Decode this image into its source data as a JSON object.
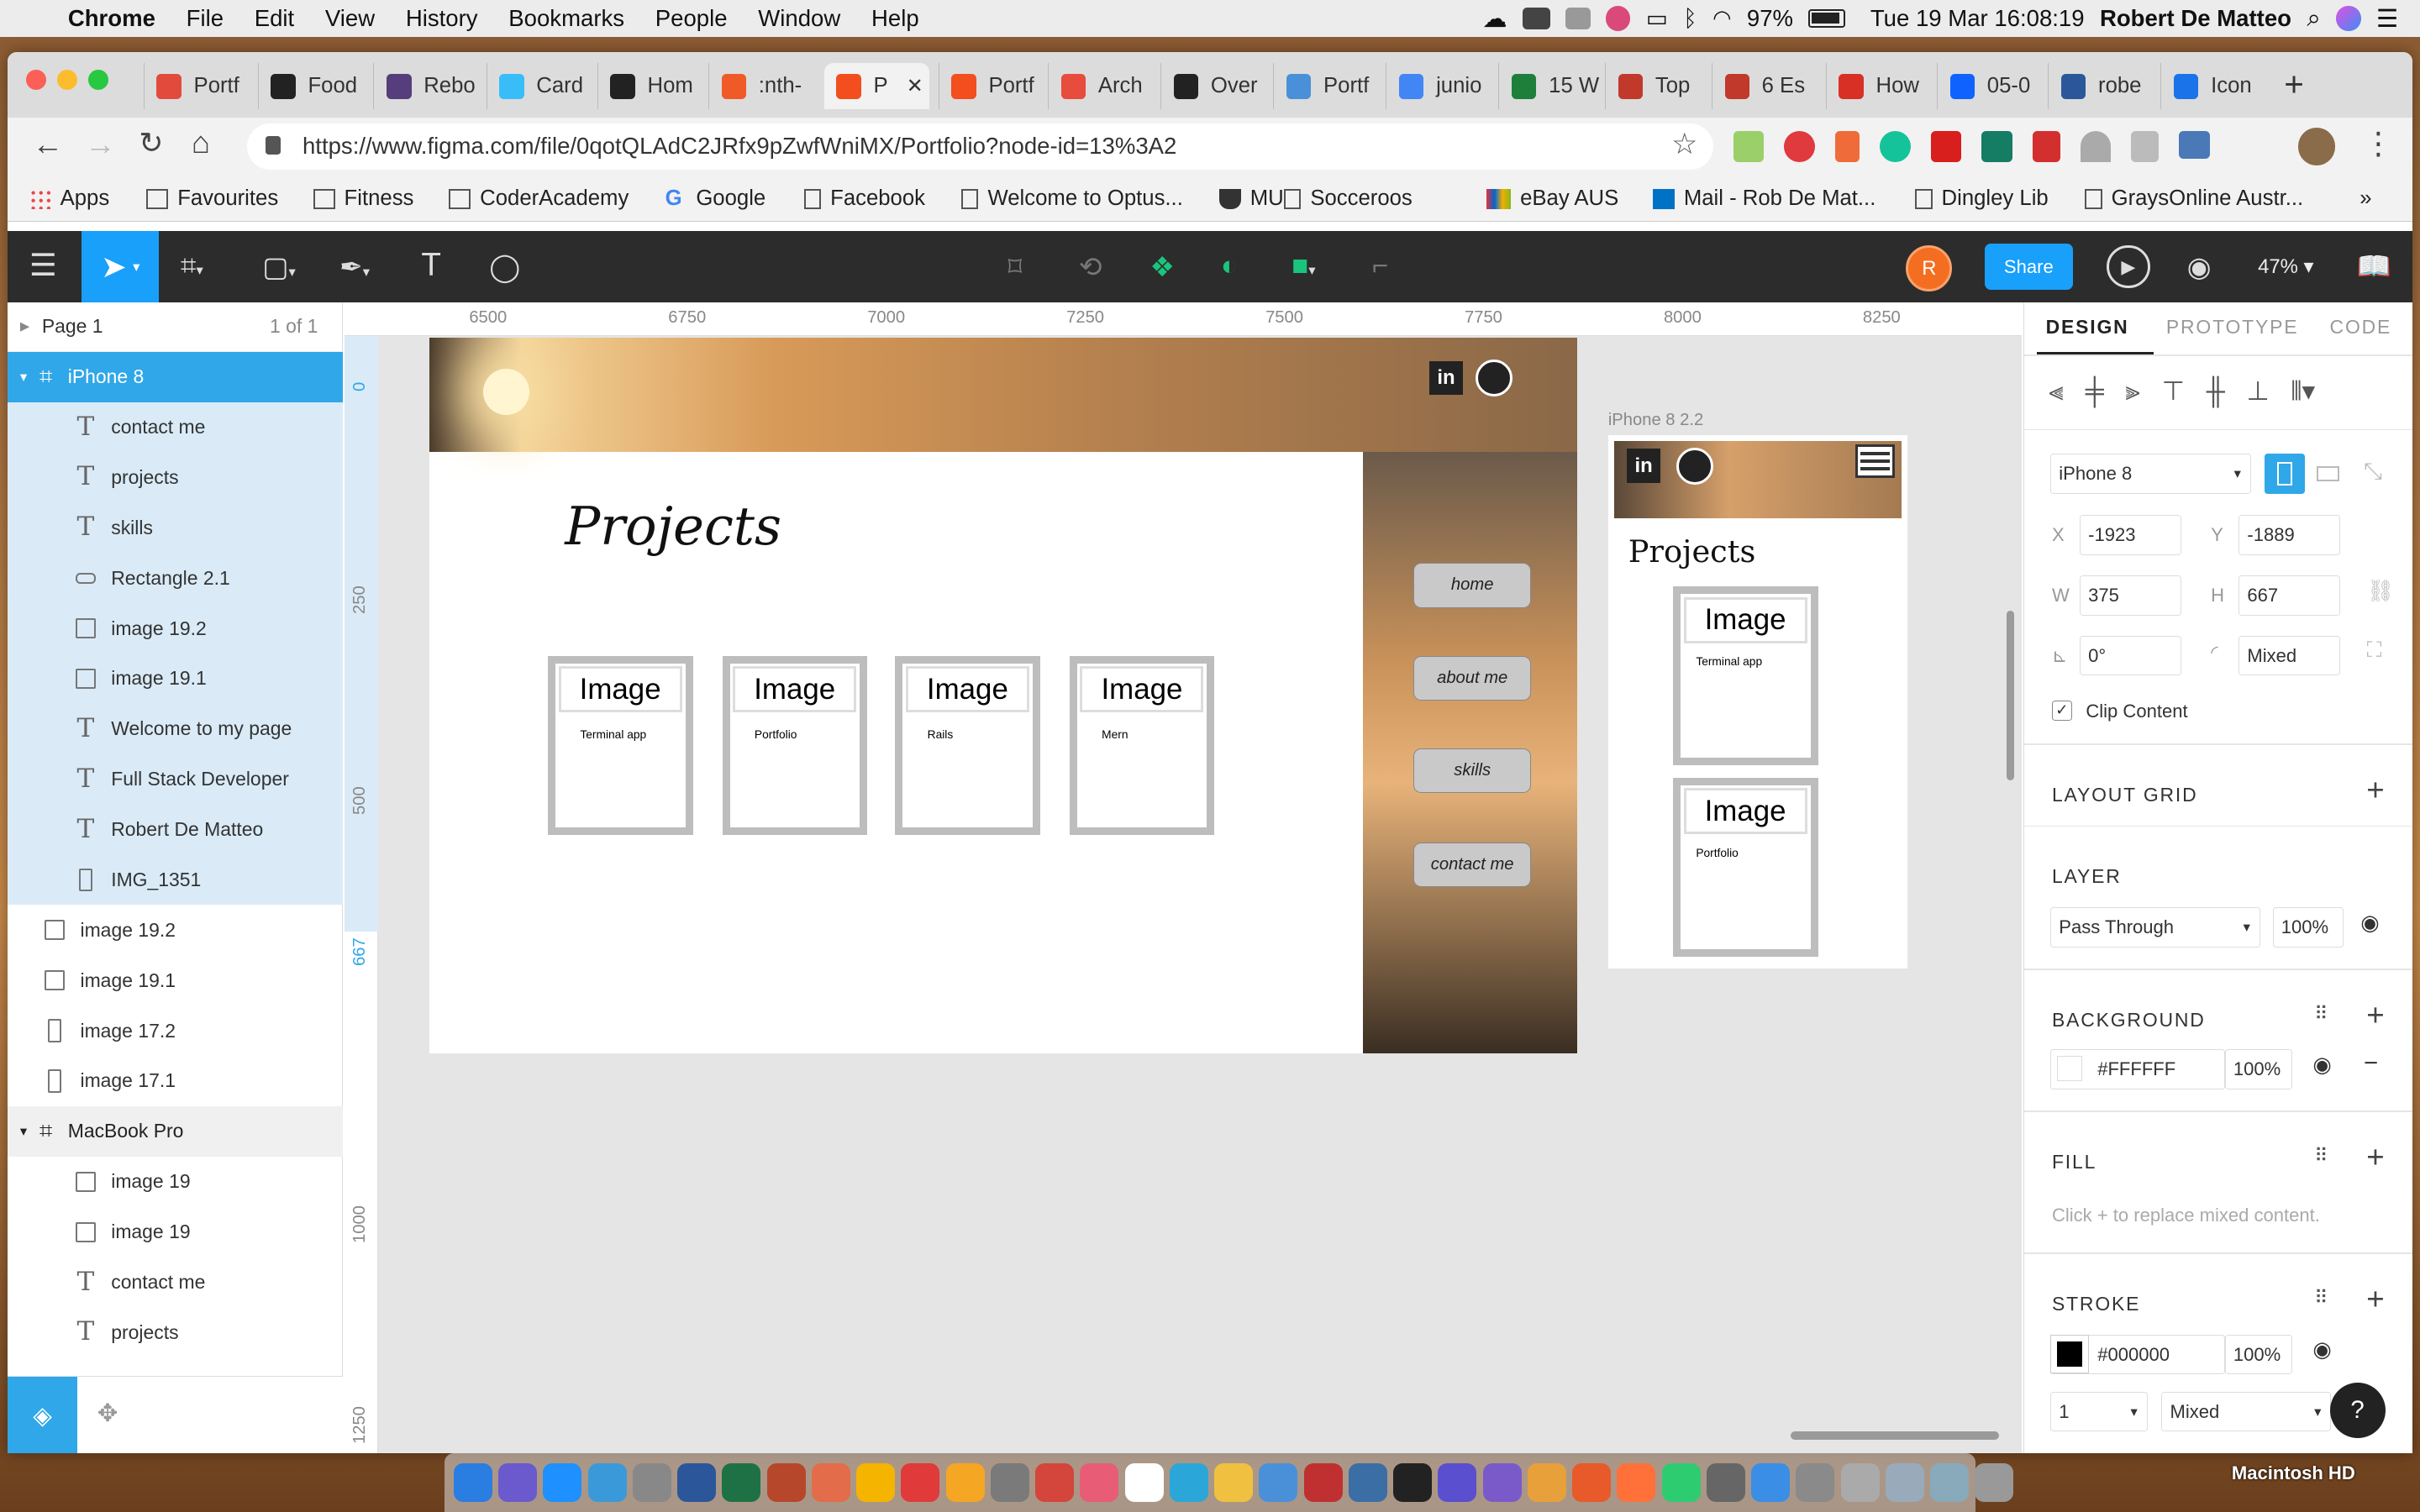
{
  "menubar": {
    "app": "Chrome",
    "items": [
      "File",
      "Edit",
      "View",
      "History",
      "Bookmarks",
      "People",
      "Window",
      "Help"
    ],
    "battery": "97%",
    "datetime": "Tue 19 Mar  16:08:19",
    "user": "Robert De Matteo"
  },
  "tabs": [
    {
      "label": "Portf",
      "color": "#e24b3b"
    },
    {
      "label": "Food",
      "color": "#222"
    },
    {
      "label": "Rebo",
      "color": "#563d7c"
    },
    {
      "label": "Card",
      "color": "#38bdf8"
    },
    {
      "label": "Hom",
      "color": "#222"
    },
    {
      "label": ":nth-",
      "color": "#f05a28"
    },
    {
      "label": "P",
      "color": "#f24e1e",
      "active": true
    },
    {
      "label": "Portf",
      "color": "#f24e1e"
    },
    {
      "label": "Arch",
      "color": "#e74c3c"
    },
    {
      "label": "Over",
      "color": "#222"
    },
    {
      "label": "Portf",
      "color": "#4a90d9"
    },
    {
      "label": "junio",
      "color": "#4285f4"
    },
    {
      "label": "15 W",
      "color": "#1e7f3a"
    },
    {
      "label": "Top",
      "color": "#c0392b"
    },
    {
      "label": "6 Es",
      "color": "#c0392b"
    },
    {
      "label": "How",
      "color": "#d93025"
    },
    {
      "label": "05-0",
      "color": "#0f62fe"
    },
    {
      "label": "robe",
      "color": "#2b579a"
    },
    {
      "label": "Icon",
      "color": "#1a73e8"
    }
  ],
  "address": {
    "url": "https://www.figma.com/file/0qotQLAdC2JRfx9pZwfWniMX/Portfolio?node-id=13%3A2"
  },
  "bookmarks": [
    "Apps",
    "Favourites",
    "Fitness",
    "CoderAcademy",
    "Google",
    "Facebook",
    "Welcome to Optus...",
    "MU",
    "Socceroos",
    "eBay AUS",
    "Mail - Rob De Mat...",
    "Dingley Lib",
    "GraysOnline Austr..."
  ],
  "figma": {
    "avatar": "R",
    "share": "Share",
    "zoom": "47%"
  },
  "layers": {
    "page": "Page 1",
    "page_count": "1 of 1",
    "frame1": "iPhone 8",
    "frame1_children": [
      {
        "type": "text",
        "label": "contact me"
      },
      {
        "type": "text",
        "label": "projects"
      },
      {
        "type": "text",
        "label": "skills"
      },
      {
        "type": "rect",
        "label": "Rectangle 2.1"
      },
      {
        "type": "image",
        "label": "image 19.2"
      },
      {
        "type": "image",
        "label": "image 19.1"
      },
      {
        "type": "text",
        "label": "Welcome to my page"
      },
      {
        "type": "text",
        "label": "Full Stack Developer"
      },
      {
        "type": "text",
        "label": "Robert De Matteo"
      },
      {
        "type": "phone",
        "label": "IMG_1351"
      }
    ],
    "loose": [
      {
        "type": "image",
        "label": "image 19.2"
      },
      {
        "type": "image",
        "label": "image 19.1"
      },
      {
        "type": "phone",
        "label": "image 17.2"
      },
      {
        "type": "phone",
        "label": "image 17.1"
      }
    ],
    "frame2": "MacBook Pro",
    "frame2_children": [
      {
        "type": "image",
        "label": "image 19"
      },
      {
        "type": "image",
        "label": "image 19"
      },
      {
        "type": "text",
        "label": "contact me"
      },
      {
        "type": "text",
        "label": "projects"
      }
    ]
  },
  "rulers": {
    "x": [
      "6500",
      "6750",
      "7000",
      "7250",
      "7500",
      "7750",
      "8000",
      "8250"
    ],
    "y": [
      "0",
      "250",
      "500",
      "667",
      "1000",
      "1250"
    ]
  },
  "canvas": {
    "desktop": {
      "title": "Projects",
      "nav": [
        "home",
        "about me",
        "skills",
        "contact me"
      ],
      "cards": [
        {
          "header": "Image",
          "body": "Terminal app"
        },
        {
          "header": "Image",
          "body": "Portfolio"
        },
        {
          "header": "Image",
          "body": "Rails"
        },
        {
          "header": "Image",
          "body": "Mern"
        }
      ]
    },
    "mobile": {
      "frame_label": "iPhone 8 2.2",
      "title": "Projects",
      "cards": [
        {
          "header": "Image",
          "body": "Terminal app"
        },
        {
          "header": "Image",
          "body": "Portfolio"
        }
      ]
    }
  },
  "design": {
    "tabs": [
      "DESIGN",
      "PROTOTYPE",
      "CODE"
    ],
    "device": "iPhone 8",
    "x": "-1923",
    "y": "-1889",
    "w": "375",
    "h": "667",
    "rotation": "0°",
    "radius": "Mixed",
    "x_label": "X",
    "y_label": "Y",
    "w_label": "W",
    "h_label": "H",
    "clip": "Clip Content",
    "layout_grid": "LAYOUT GRID",
    "layer": "LAYER",
    "blend": "Pass Through",
    "layer_opacity": "100%",
    "background": "BACKGROUND",
    "bg_hex": "#FFFFFF",
    "bg_opacity": "100%",
    "fill": "FILL",
    "fill_hint": "Click + to replace mixed content.",
    "stroke": "STROKE",
    "stroke_hex": "#000000",
    "stroke_opacity": "100%",
    "stroke_width": "1",
    "stroke_align": "Mixed"
  },
  "help": "?",
  "disk": "Macintosh HD"
}
